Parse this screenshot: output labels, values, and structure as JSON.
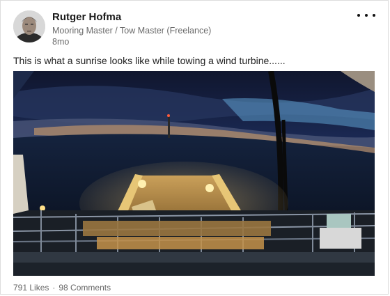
{
  "post": {
    "author_name": "Rutger Hofma",
    "author_headline": "Mooring Master / Tow Master (Freelance)",
    "age": "8mo",
    "text": "This is what a sunrise looks like while towing a wind turbine......",
    "likes": "791 Likes",
    "separator": "·",
    "comments": "98 Comments"
  },
  "icons": {
    "more": "more-horizontal-icon",
    "avatar": "profile-photo"
  },
  "colors": {
    "name": "#1a1a1a",
    "meta": "#6a6a6a",
    "deck_light": "#e8b04a",
    "sky_dark": "#141c3a"
  }
}
